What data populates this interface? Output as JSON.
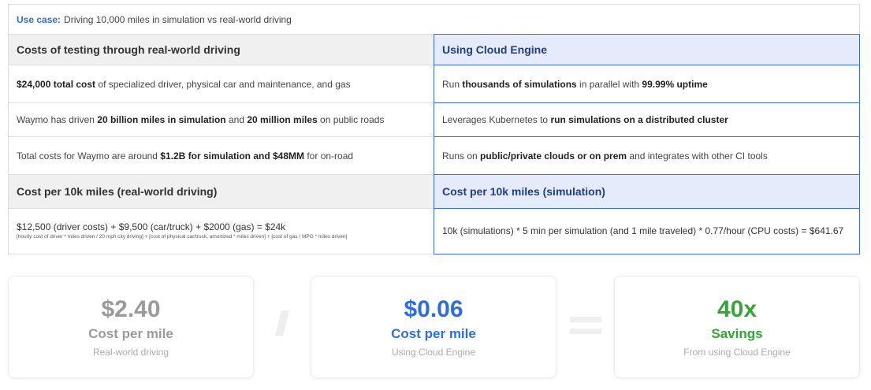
{
  "use_case": {
    "label": "Use case:",
    "text": "Driving 10,000 miles in simulation vs real-world driving"
  },
  "left": {
    "header": "Costs of testing through real-world driving",
    "rows": [
      {
        "b": "$24,000 total cost",
        "t": " of specialized driver, physical car and maintenance, and gas"
      },
      {
        "t1": "Waymo has driven ",
        "b1": "20 billion miles in simulation",
        "t2": " and ",
        "b2": "20 million miles",
        "t3": " on public roads"
      },
      {
        "t1": "Total costs for Waymo are around ",
        "b1": "$1.2B for simulation and $48MM",
        "t2": " for on-road"
      }
    ],
    "cost_header": "Cost per 10k miles (real-world driving)",
    "cost_formula": "$12,500 (driver costs) + $9,500 (car/truck) + $2000 (gas) = $24k",
    "cost_note": "[hourly cost of driver * miles driven / 20 mph city driving] + [cost of physical car/truck, amortized * miles driven] + [cost of gas / MPG * miles driven]"
  },
  "right": {
    "header": "Using Cloud Engine",
    "rows": [
      {
        "t1": "Run ",
        "b1": "thousands of simulations",
        "t2": " in parallel with ",
        "b2": "99.99% uptime"
      },
      {
        "t1": "Leverages Kubernetes to ",
        "b1": "run simulations on a distributed cluster"
      },
      {
        "t1": "Runs on ",
        "b1": "public/private clouds or on prem",
        "t2": " and integrates with other CI tools"
      }
    ],
    "cost_header": "Cost per 10k miles (simulation)",
    "cost_formula": "10k (simulations) * 5 min per simulation (and 1 mile traveled) * 0.77/hour (CPU costs) = $641.67"
  },
  "cards": [
    {
      "value": "$2.40",
      "label": "Cost per mile",
      "sub": "Real-world driving",
      "color": "#9a9a9a"
    },
    {
      "value": "$0.06",
      "label": "Cost per mile",
      "sub": "Using Cloud Engine",
      "color": "#2b6fdf"
    },
    {
      "value": "40x",
      "label": "Savings",
      "sub": "From using Cloud Engine",
      "color": "#35a535"
    }
  ],
  "colors": {
    "accent_blue": "#2b6fdf",
    "dark_blue": "#1d3f86",
    "green": "#35a535",
    "header_blue_bg": "#e6ebfb",
    "border_blue": "#3d6fd8"
  }
}
